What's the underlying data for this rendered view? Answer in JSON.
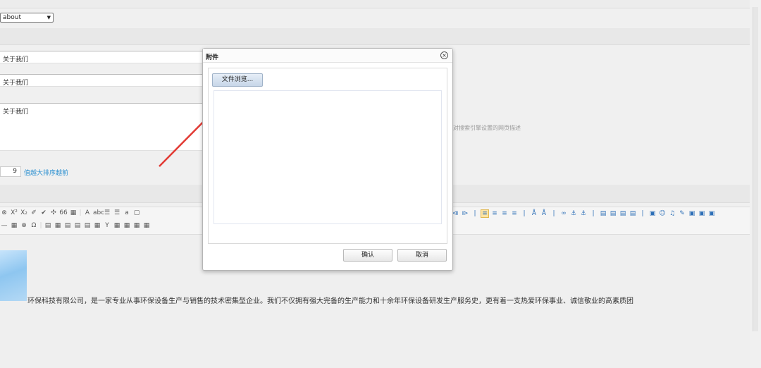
{
  "top_select": {
    "value": "about"
  },
  "fields": {
    "title": "关于我们",
    "keywords": "关于我们",
    "description": "关于我们",
    "description_hint": "对搜索引擎设置的网页描述"
  },
  "sort": {
    "value": "9",
    "hint": "值越大排序越前"
  },
  "toolbar": {
    "row1": [
      "⊗",
      "X²",
      "X₂",
      "✐",
      "✔",
      "✣",
      "66",
      "▦",
      "|",
      "A",
      "abc",
      "☰",
      "☰",
      "a",
      "▢"
    ],
    "row2": [
      "—",
      "▦",
      "⊕",
      "Ω",
      "|",
      "▤",
      "▦",
      "▤",
      "▤",
      "▤",
      "▦",
      "Y",
      "▦",
      "▦",
      "▦",
      "▦"
    ],
    "right_row1": [
      "⧏",
      "⧐",
      "|",
      "≡",
      "≡",
      "≡",
      "≡",
      "|",
      "Å",
      "Å",
      "|",
      "∞",
      "⚓",
      "⚓",
      "|",
      "▤",
      "▤",
      "▤",
      "▤",
      "|",
      "▣",
      "☺",
      "♫",
      "✎",
      "▣",
      "▣",
      "▣"
    ]
  },
  "editor": {
    "body_text": "环保科技有限公司，是一家专业从事环保设备生产与销售的技术密集型企业。我们不仅拥有强大完备的生产能力和十余年环保设备研发生产服务史，更有着一支热爱环保事业、诚信敬业的高素质团"
  },
  "dialog": {
    "title": "附件",
    "close_icon": "close-icon",
    "browse_label": "文件浏览...",
    "confirm_label": "确认",
    "cancel_label": "取消"
  },
  "colors": {
    "arrow": "#e23b35",
    "link": "#2a8fd0",
    "toolbar_active": "#ffe4a3"
  }
}
